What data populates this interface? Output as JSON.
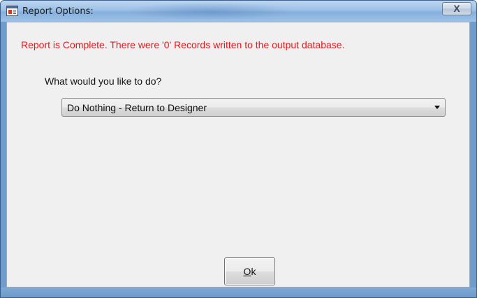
{
  "window": {
    "title": "Report Options:",
    "close_label": "X"
  },
  "dialog": {
    "status_message": "Report is Complete.  There were '0' Records written to the output database.",
    "question": "What would you like to do?",
    "action_select": {
      "selected_value": "Do Nothing - Return to Designer"
    },
    "ok_button": {
      "mnemonic": "O",
      "rest": "k"
    }
  },
  "colors": {
    "status_text": "#e8181e",
    "dialog_background": "#f0f0f0",
    "titlebar": "#9cc0e6"
  },
  "icons": {
    "title": "report-window-icon",
    "close": "close-icon",
    "dropdown": "chevron-down-icon"
  }
}
